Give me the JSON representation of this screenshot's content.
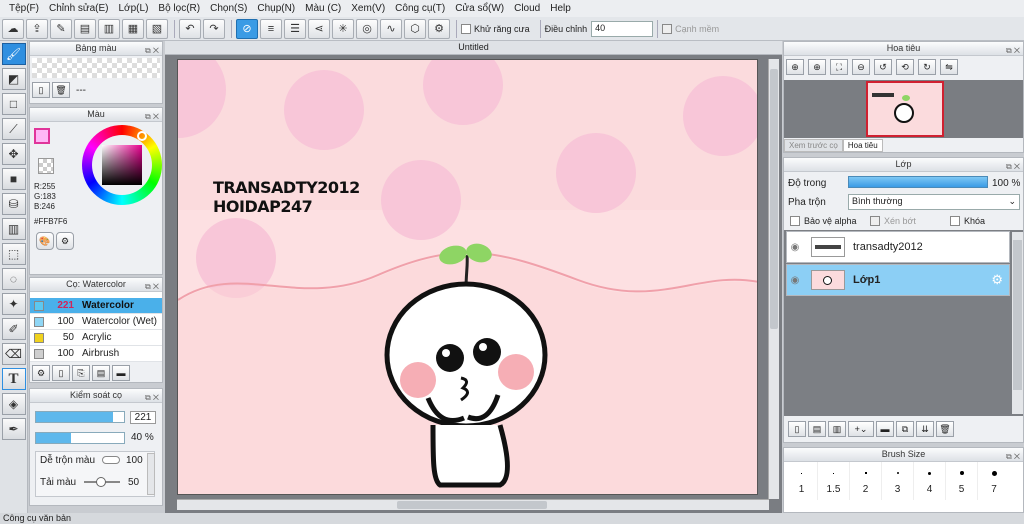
{
  "menu": [
    "Tệp(F)",
    "Chỉnh sửa(E)",
    "Lớp(L)",
    "Bộ lọc(R)",
    "Chọn(S)",
    "Chụp(N)",
    "Màu (C)",
    "Xem(V)",
    "Công cụ(T)",
    "Cửa sổ(W)",
    "Cloud",
    "Help"
  ],
  "toolbar": {
    "antialias_label": "Khử răng cưa",
    "adjust_label": "Điều chỉnh",
    "adjust_value": "40",
    "smooth_label": "Cạnh mềm"
  },
  "swatch_panel": {
    "title": "Bảng màu",
    "extra": "---"
  },
  "color_panel": {
    "title": "Màu",
    "r": "R:255",
    "g": "G:183",
    "b": "B:246",
    "hex": "#FFB7F6"
  },
  "brush_panel": {
    "title": "Cọ: Watercolor",
    "items": [
      {
        "num": "221",
        "name": "Watercolor",
        "color": "#5cc8f0"
      },
      {
        "num": "100",
        "name": "Watercolor (Wet)",
        "color": "#8fd6f5"
      },
      {
        "num": "50",
        "name": "Acrylic",
        "color": "#f0d21e"
      },
      {
        "num": "100",
        "name": "Airbrush",
        "color": "#cfcfcf"
      }
    ]
  },
  "brush_control": {
    "title": "Kiểm soát cọ",
    "size": "221",
    "opacity": "40 %",
    "blend_label": "Dễ trộn màu",
    "blend_value": "100",
    "load_label": "Tải màu",
    "load_value": "50",
    "size_fill": 0.88,
    "opacity_fill": 0.4
  },
  "canvas": {
    "tab": "Untitled",
    "text1": "TRANSADTY2012",
    "text2": "HOIDAP247"
  },
  "navigator": {
    "title": "Hoa tiêu",
    "tab1": "Xem trước cọ",
    "tab2": "Hoa tiêu"
  },
  "layers": {
    "title": "Lớp",
    "opacity_label": "Độ trong",
    "opacity_value": "100 %",
    "blend_label": "Pha trộn",
    "blend_value": "Bình thường",
    "protect_alpha": "Bảo vệ alpha",
    "clip": "Xén bớt",
    "lock": "Khóa",
    "items": [
      {
        "name": "transadty2012",
        "selected": false
      },
      {
        "name": "Lớp1",
        "selected": true
      }
    ]
  },
  "brush_size": {
    "title": "Brush Size",
    "sizes": [
      "1",
      "1.5",
      "2",
      "3",
      "4",
      "5",
      "7"
    ]
  },
  "status": "Công cụ văn bản",
  "colors": {
    "accent": "#2f8fe0",
    "canvas_bg": "#fbdbdd",
    "circle": "#f8c6d8"
  }
}
